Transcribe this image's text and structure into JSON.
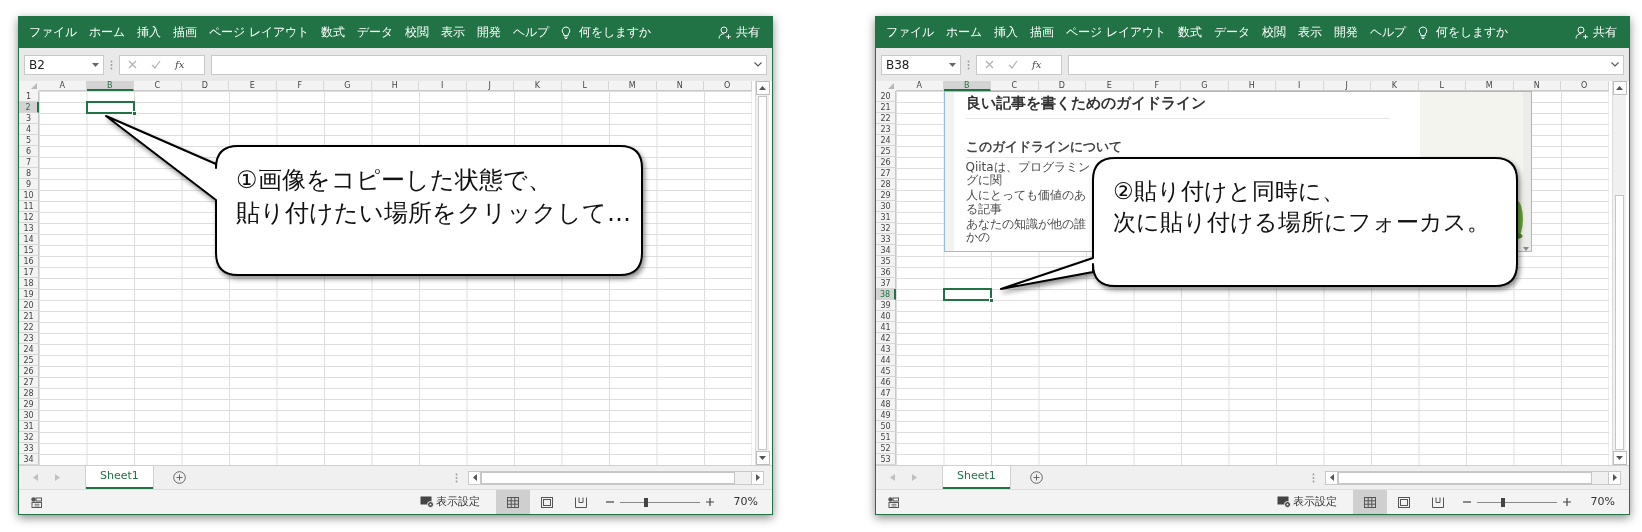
{
  "windows": [
    {
      "menu": [
        "ファイル",
        "ホーム",
        "挿入",
        "描画",
        "ページ レイアウト",
        "数式",
        "データ",
        "校閲",
        "表示",
        "開発",
        "ヘルプ"
      ],
      "tell_me": "何をしますか",
      "share": "共有",
      "name_box": "B2",
      "function_label": "fx",
      "columns": [
        {
          "label": "A",
          "selected": false
        },
        {
          "label": "B",
          "selected": true
        },
        {
          "label": "C",
          "selected": false
        },
        {
          "label": "D",
          "selected": false
        },
        {
          "label": "E",
          "selected": false
        },
        {
          "label": "F",
          "selected": false
        },
        {
          "label": "G",
          "selected": false
        },
        {
          "label": "H",
          "selected": false
        },
        {
          "label": "I",
          "selected": false
        },
        {
          "label": "J",
          "selected": false
        },
        {
          "label": "K",
          "selected": false
        },
        {
          "label": "L",
          "selected": false
        },
        {
          "label": "M",
          "selected": false
        },
        {
          "label": "N",
          "selected": false
        },
        {
          "label": "O",
          "selected": false
        }
      ],
      "rows": [
        {
          "label": "1",
          "selected": false
        },
        {
          "label": "2",
          "selected": true
        },
        {
          "label": "3",
          "selected": false
        },
        {
          "label": "4",
          "selected": false
        },
        {
          "label": "5",
          "selected": false
        },
        {
          "label": "6",
          "selected": false
        },
        {
          "label": "7",
          "selected": false
        },
        {
          "label": "8",
          "selected": false
        },
        {
          "label": "9",
          "selected": false
        },
        {
          "label": "10",
          "selected": false
        },
        {
          "label": "11",
          "selected": false
        },
        {
          "label": "12",
          "selected": false
        },
        {
          "label": "13",
          "selected": false
        },
        {
          "label": "14",
          "selected": false
        },
        {
          "label": "15",
          "selected": false
        },
        {
          "label": "16",
          "selected": false
        },
        {
          "label": "17",
          "selected": false
        },
        {
          "label": "18",
          "selected": false
        },
        {
          "label": "19",
          "selected": false
        },
        {
          "label": "20",
          "selected": false
        },
        {
          "label": "21",
          "selected": false
        },
        {
          "label": "22",
          "selected": false
        },
        {
          "label": "23",
          "selected": false
        },
        {
          "label": "24",
          "selected": false
        },
        {
          "label": "25",
          "selected": false
        },
        {
          "label": "26",
          "selected": false
        },
        {
          "label": "27",
          "selected": false
        },
        {
          "label": "28",
          "selected": false
        },
        {
          "label": "29",
          "selected": false
        },
        {
          "label": "30",
          "selected": false
        },
        {
          "label": "31",
          "selected": false
        },
        {
          "label": "32",
          "selected": false
        },
        {
          "label": "33",
          "selected": false
        },
        {
          "label": "34",
          "selected": false
        }
      ],
      "sheet_tabs": [
        {
          "label": "Sheet1",
          "selected": true
        }
      ],
      "display_settings": "表示設定",
      "views": [
        {
          "kind": "normal",
          "selected": true
        },
        {
          "kind": "page_layout",
          "selected": false
        },
        {
          "kind": "page_break",
          "selected": false
        }
      ],
      "zoom": {
        "level": 0.33,
        "reading": "70%"
      },
      "callout": [
        "①画像をコピーした状態で、",
        "貼り付けたい場所をクリックして…"
      ]
    },
    {
      "menu": [
        "ファイル",
        "ホーム",
        "挿入",
        "描画",
        "ページ レイアウト",
        "数式",
        "データ",
        "校閲",
        "表示",
        "開発",
        "ヘルプ"
      ],
      "tell_me": "何をしますか",
      "share": "共有",
      "name_box": "B38",
      "function_label": "fx",
      "columns": [
        {
          "label": "A",
          "selected": false
        },
        {
          "label": "B",
          "selected": true
        },
        {
          "label": "C",
          "selected": false
        },
        {
          "label": "D",
          "selected": false
        },
        {
          "label": "E",
          "selected": false
        },
        {
          "label": "F",
          "selected": false
        },
        {
          "label": "G",
          "selected": false
        },
        {
          "label": "H",
          "selected": false
        },
        {
          "label": "I",
          "selected": false
        },
        {
          "label": "J",
          "selected": false
        },
        {
          "label": "K",
          "selected": false
        },
        {
          "label": "L",
          "selected": false
        },
        {
          "label": "M",
          "selected": false
        },
        {
          "label": "N",
          "selected": false
        },
        {
          "label": "O",
          "selected": false
        }
      ],
      "rows": [
        {
          "label": "20",
          "selected": false
        },
        {
          "label": "21",
          "selected": false
        },
        {
          "label": "22",
          "selected": false
        },
        {
          "label": "23",
          "selected": false
        },
        {
          "label": "24",
          "selected": false
        },
        {
          "label": "25",
          "selected": false
        },
        {
          "label": "26",
          "selected": false
        },
        {
          "label": "27",
          "selected": false
        },
        {
          "label": "28",
          "selected": false
        },
        {
          "label": "29",
          "selected": false
        },
        {
          "label": "30",
          "selected": false
        },
        {
          "label": "31",
          "selected": false
        },
        {
          "label": "32",
          "selected": false
        },
        {
          "label": "33",
          "selected": false
        },
        {
          "label": "34",
          "selected": false
        },
        {
          "label": "35",
          "selected": false
        },
        {
          "label": "36",
          "selected": false
        },
        {
          "label": "37",
          "selected": false
        },
        {
          "label": "38",
          "selected": true
        },
        {
          "label": "39",
          "selected": false
        },
        {
          "label": "40",
          "selected": false
        },
        {
          "label": "41",
          "selected": false
        },
        {
          "label": "42",
          "selected": false
        },
        {
          "label": "43",
          "selected": false
        },
        {
          "label": "44",
          "selected": false
        },
        {
          "label": "45",
          "selected": false
        },
        {
          "label": "46",
          "selected": false
        },
        {
          "label": "47",
          "selected": false
        },
        {
          "label": "48",
          "selected": false
        },
        {
          "label": "49",
          "selected": false
        },
        {
          "label": "50",
          "selected": false
        },
        {
          "label": "51",
          "selected": false
        },
        {
          "label": "52",
          "selected": false
        },
        {
          "label": "53",
          "selected": false
        }
      ],
      "pasted_image": {
        "title": "良い記事を書くためのガイドライン",
        "heading": "このガイドラインについて",
        "paragraphs": [
          "Qiitaは、プログラミングに関",
          "人にとっても価値のある記事",
          "あなたの知識が他の誰かの"
        ]
      },
      "sheet_tabs": [
        {
          "label": "Sheet1",
          "selected": true
        }
      ],
      "display_settings": "表示設定",
      "views": [
        {
          "kind": "normal",
          "selected": true
        },
        {
          "kind": "page_layout",
          "selected": false
        },
        {
          "kind": "page_break",
          "selected": false
        }
      ],
      "zoom": {
        "level": 0.33,
        "reading": "70%"
      },
      "callout": [
        "②貼り付けと同時に、",
        "次に貼り付ける場所にフォーカス。"
      ]
    }
  ]
}
